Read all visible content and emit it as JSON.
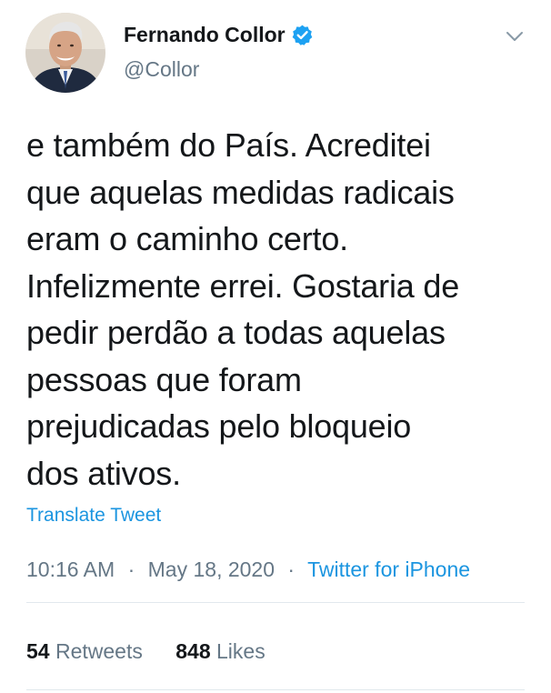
{
  "author": {
    "name": "Fernando Collor",
    "handle": "@Collor",
    "verified": true,
    "avatar_icon": "avatar-photo"
  },
  "tweet": {
    "text": "e também do País. Acreditei\nque aquelas medidas radicais\neram o caminho certo.\nInfelizmente errei. Gostaria de\npedir perdão a todas aquelas\npessoas que foram\nprejudicadas pelo bloqueio\ndos ativos.",
    "translate_label": "Translate Tweet"
  },
  "meta": {
    "time": "10:16 AM",
    "date": "May 18, 2020",
    "separator": "·",
    "source": "Twitter for iPhone"
  },
  "stats": {
    "retweets_count": "54",
    "retweets_label": "Retweets",
    "likes_count": "848",
    "likes_label": "Likes"
  },
  "colors": {
    "text": "#14171a",
    "secondary": "#657786",
    "link": "#1b95e0",
    "verified": "#1da1f2",
    "divider": "#e1e8ed"
  }
}
